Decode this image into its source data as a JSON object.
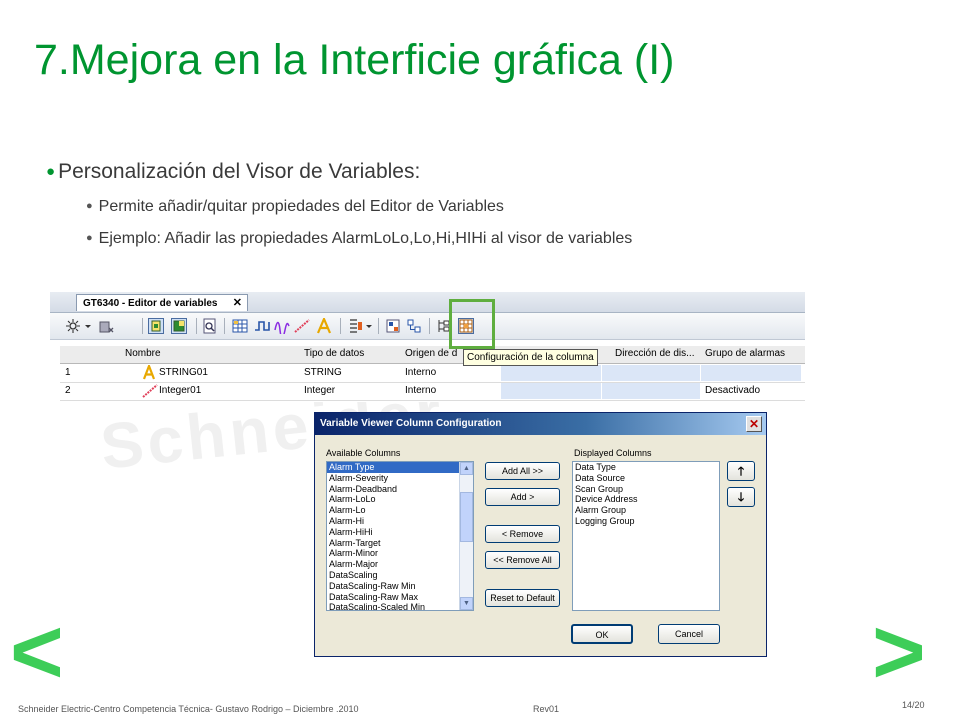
{
  "slide": {
    "title": "7.Mejora en la Interficie gráfica (I)",
    "bullet_main": "Personalización del Visor de Variables:",
    "bullet_sub1": "Permite añadir/quitar propiedades del Editor de Variables",
    "bullet_sub2": "Ejemplo: Añadir las propiedades AlarmLoLo,Lo,Hi,HIHi al visor de variables",
    "bullet_symbol": "●",
    "watermark": "Schneider",
    "footer": "Schneider Electric-Centro Competencia Técnica- Gustavo Rodrigo – Diciembre .2010",
    "revision": "Rev01",
    "page_number": "14/20",
    "prev_arrow": "<",
    "next_arrow": ">"
  },
  "editor": {
    "tab_title": "GT6340 - Editor de variables",
    "tab_close": "✕",
    "tooltip": "Configuración de la columna",
    "columns": [
      "Nombre",
      "Tipo de datos",
      "Origen de d",
      "Dirección de dis...",
      "Grupo de alarmas"
    ],
    "rows": [
      {
        "num": "1",
        "name": "STRING01",
        "type": "STRING",
        "source": "Interno",
        "alarm": ""
      },
      {
        "num": "2",
        "name": "Integer01",
        "type": "Integer",
        "source": "Interno",
        "alarm": "Desactivado"
      }
    ]
  },
  "dialog": {
    "title": "Variable Viewer Column Configuration",
    "close": "✕",
    "available_label": "Available Columns",
    "displayed_label": "Displayed Columns",
    "available": [
      "Alarm Type",
      "Alarm-Severity",
      "Alarm-Deadband",
      "Alarm-LoLo",
      "Alarm-Lo",
      "Alarm-Hi",
      "Alarm-HiHi",
      "Alarm-Target",
      "Alarm-Minor",
      "Alarm-Major",
      "DataScaling",
      "DataScaling-Raw Min",
      "DataScaling-Raw Max",
      "DataScaling-Scaled Min"
    ],
    "selected_available": "Alarm Type",
    "displayed": [
      "Data Type",
      "Data Source",
      "Scan Group",
      "Device Address",
      "Alarm Group",
      "Logging Group"
    ],
    "buttons": {
      "add_all": "Add All >>",
      "add": "Add >",
      "remove": "< Remove",
      "remove_all": "<< Remove All",
      "reset": "Reset to Default",
      "ok": "OK",
      "cancel": "Cancel",
      "up": "🡑",
      "down": "🡓"
    }
  },
  "colors": {
    "title_green": "#009530",
    "arrow_green": "#3dcd58",
    "highlight_green": "#5fae3f"
  }
}
